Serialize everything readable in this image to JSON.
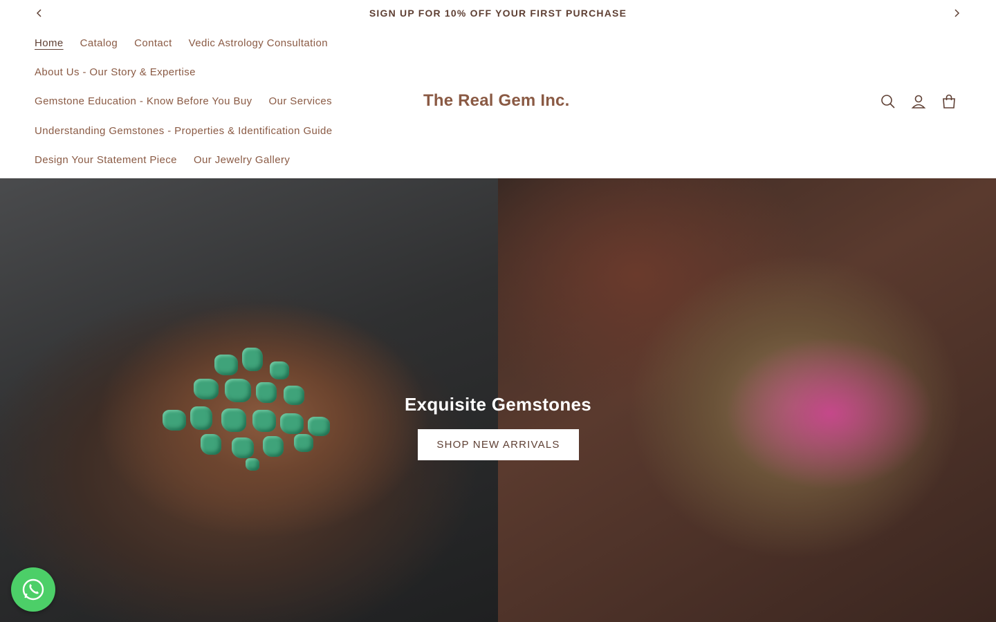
{
  "announcement": {
    "text": "SIGN UP FOR 10% OFF YOUR FIRST PURCHASE"
  },
  "nav": {
    "rows": [
      [
        "Home",
        "Catalog",
        "Contact",
        "Vedic Astrology Consultation"
      ],
      [
        "About Us - Our Story & Expertise"
      ],
      [
        "Gemstone Education - Know Before You Buy",
        "Our Services"
      ],
      [
        "Understanding Gemstones - Properties & Identification Guide"
      ],
      [
        "Design Your Statement Piece",
        "Our Jewelry Gallery"
      ]
    ],
    "active": "Home"
  },
  "logo": "The Real Gem Inc.",
  "header_icons": [
    "search-icon",
    "account-icon",
    "cart-icon"
  ],
  "hero": {
    "title": "Exquisite Gemstones",
    "button_label": "SHOP NEW ARRIVALS"
  },
  "colors": {
    "brand_text": "#8a5a44",
    "dark_text": "#5e3f33",
    "whatsapp_green": "#4ccf68"
  }
}
